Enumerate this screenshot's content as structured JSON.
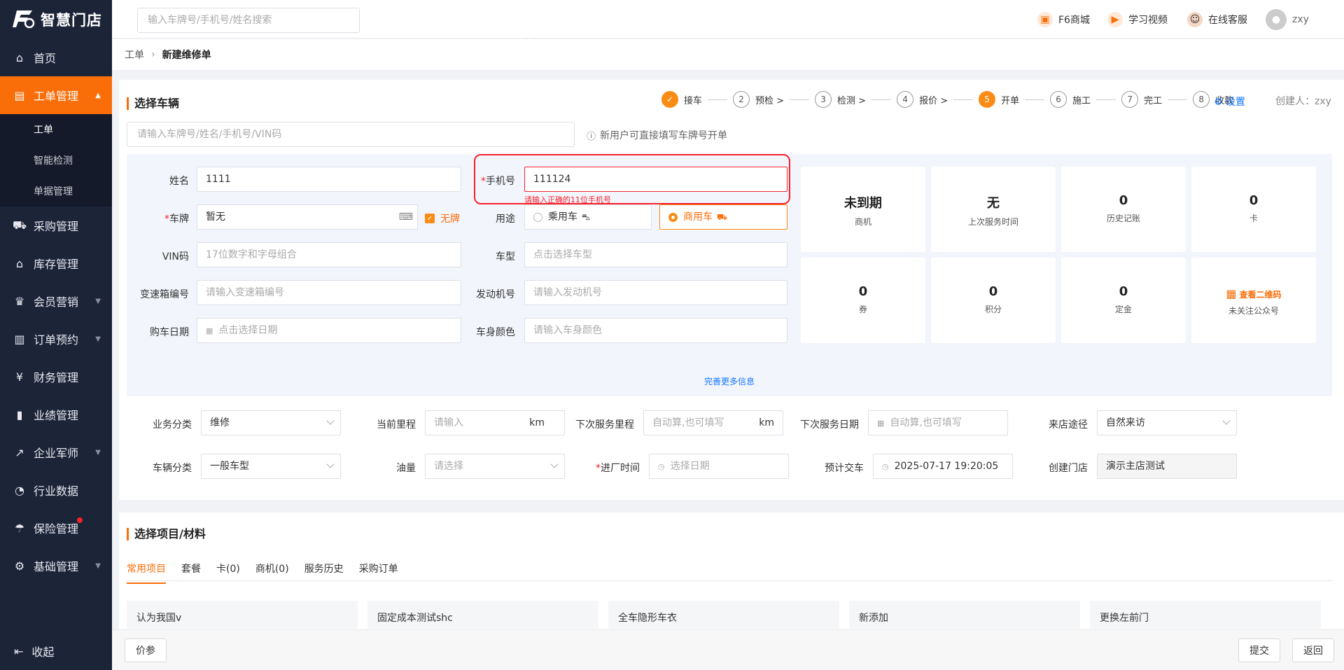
{
  "app": {
    "name": "智慧门店"
  },
  "topbar": {
    "search_placeholder": "输入车牌号/手机号/姓名搜索",
    "mall": "F6商城",
    "video": "学习视频",
    "service": "在线客服",
    "user": "zxy"
  },
  "sidebar": {
    "items": [
      {
        "label": "首页",
        "icon": "home-icon"
      },
      {
        "label": "工单管理",
        "icon": "order-icon",
        "active": true
      },
      {
        "label": "采购管理",
        "icon": "cart-icon"
      },
      {
        "label": "库存管理",
        "icon": "warehouse-icon"
      },
      {
        "label": "会员营销",
        "icon": "crown-icon"
      },
      {
        "label": "订单预约",
        "icon": "clipboard-icon"
      },
      {
        "label": "财务管理",
        "icon": "yen-icon"
      },
      {
        "label": "业绩管理",
        "icon": "bar-chart-icon"
      },
      {
        "label": "企业军师",
        "icon": "trend-icon"
      },
      {
        "label": "行业数据",
        "icon": "gauge-icon"
      },
      {
        "label": "保险管理",
        "icon": "umbrella-icon"
      },
      {
        "label": "基础管理",
        "icon": "gear-icon"
      }
    ],
    "sub_items": [
      "工单",
      "智能检测",
      "单据管理"
    ],
    "collapse": "收起"
  },
  "breadcrumb": {
    "parent": "工单",
    "current": "新建维修单"
  },
  "vehicle": {
    "title": "选择车辆",
    "search_placeholder": "请输入车牌号/姓名/手机号/VIN码",
    "hint": "新用户可直接填写车牌号开单",
    "creator": "创建人：zxy",
    "settings": "设置"
  },
  "steps": [
    {
      "n": "",
      "label": "接车"
    },
    {
      "n": "2",
      "label": "预检 >"
    },
    {
      "n": "3",
      "label": "检测 >"
    },
    {
      "n": "4",
      "label": "报价 >"
    },
    {
      "n": "5",
      "label": "开单"
    },
    {
      "n": "6",
      "label": "施工"
    },
    {
      "n": "7",
      "label": "完工"
    },
    {
      "n": "8",
      "label": "收款"
    }
  ],
  "form": {
    "name_label": "姓名",
    "name_value": "1111",
    "phone_label": "手机号",
    "phone_value": "111124",
    "phone_error": "请输入正确的11位手机号",
    "plate_label": "车牌",
    "plate_value": "暂无",
    "no_plate": "无牌",
    "usage_label": "用途",
    "usage_passenger": "乘用车",
    "usage_commercial": "商用车",
    "vin_label": "VIN码",
    "vin_placeholder": "17位数字和字母组合",
    "model_label": "车型",
    "model_placeholder": "点击选择车型",
    "gearbox_label": "变速箱编号",
    "gearbox_placeholder": "请输入变速箱编号",
    "engine_label": "发动机号",
    "engine_placeholder": "请输入发动机号",
    "buydate_label": "购车日期",
    "buydate_placeholder": "点击选择日期",
    "color_label": "车身颜色",
    "color_placeholder": "请输入车身颜色",
    "more": "完善更多信息"
  },
  "stats": [
    {
      "value": "未到期",
      "label": "商机"
    },
    {
      "value": "无",
      "label": "上次服务时间"
    },
    {
      "value": "0",
      "label": "历史记账"
    },
    {
      "value": "0",
      "label": "卡"
    },
    {
      "value": "0",
      "label": "券"
    },
    {
      "value": "0",
      "label": "积分"
    },
    {
      "value": "0",
      "label": "定金"
    },
    {
      "value": "查看二维码",
      "label": "未关注公众号"
    }
  ],
  "order": {
    "biz_label": "业务分类",
    "biz_value": "维修",
    "mileage_label": "当前里程",
    "mileage_placeholder": "请输入",
    "km": "km",
    "next_mileage_label": "下次服务里程",
    "next_mileage_placeholder": "自动算,也可填写",
    "next_date_label": "下次服务日期",
    "next_date_placeholder": "自动算,也可填写",
    "source_label": "来店途径",
    "source_value": "自然来访",
    "vclass_label": "车辆分类",
    "vclass_value": "一般车型",
    "oil_label": "油量",
    "oil_placeholder": "请选择",
    "entry_label": "进厂时间",
    "entry_placeholder": "选择日期",
    "deliver_label": "预计交车",
    "deliver_value": "2025-07-17 19:20:05",
    "store_label": "创建门店",
    "store_value": "演示主店测试"
  },
  "items": {
    "title": "选择项目/材料",
    "tabs": [
      "常用项目",
      "套餐",
      "卡(0)",
      "商机(0)",
      "服务历史",
      "采购订单"
    ],
    "cards": [
      "认为我国v",
      "固定成本测试shc",
      "全车隐形车衣",
      "新添加",
      "更换左前门"
    ]
  },
  "footer": {
    "price": "价参",
    "submit": "提交",
    "back": "返回"
  },
  "colors": {
    "accent": "#fa6e0a",
    "sidebar": "#1c2438",
    "error": "#f5222d",
    "link": "#1677ff"
  }
}
